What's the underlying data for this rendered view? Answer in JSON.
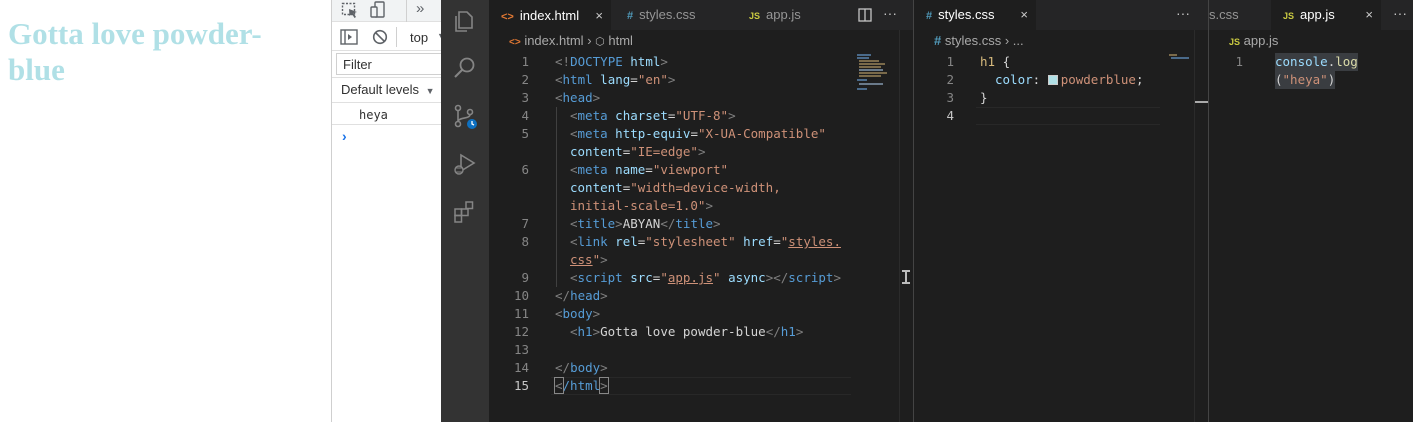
{
  "page": {
    "heading": "Gotta love powder-blue"
  },
  "devtools": {
    "context": "top",
    "filter_placeholder": "Filter",
    "levels_label": "Default levels",
    "log_entry": "heya",
    "prompt": "›"
  },
  "editor1": {
    "tabs": [
      {
        "icon": "<>",
        "label": "index.html",
        "close": "×"
      },
      {
        "icon": "#",
        "label": "styles.css"
      },
      {
        "icon": "JS",
        "label": "app.js"
      }
    ],
    "breadcrumb": {
      "file": "index.html",
      "sep": "›",
      "node": "html"
    },
    "line_numbers": [
      "1",
      "2",
      "3",
      "4",
      "5",
      "6",
      "7",
      "8",
      "9",
      "10",
      "11",
      "12",
      "13",
      "14",
      "15"
    ],
    "code": {
      "l1": {
        "a": "<!",
        "b": "DOCTYPE",
        "c": " html",
        "d": ">"
      },
      "l2": {
        "a": "<",
        "b": "html",
        "c": " lang",
        "d": "=",
        "e": "\"en\"",
        "f": ">"
      },
      "l3": {
        "a": "<",
        "b": "head",
        "c": ">"
      },
      "l4": {
        "a": "<",
        "b": "meta",
        "c": " charset",
        "d": "=",
        "e": "\"UTF-8\"",
        "f": ">"
      },
      "l5a": {
        "a": "<",
        "b": "meta",
        "c": " http-equiv",
        "d": "=",
        "e": "\"X-UA-Compatible\""
      },
      "l5b": {
        "a": "content",
        "b": "=",
        "c": "\"IE=edge\"",
        "d": ">"
      },
      "l6a": {
        "a": "<",
        "b": "meta",
        "c": " name",
        "d": "=",
        "e": "\"viewport\""
      },
      "l6b": {
        "a": "content",
        "b": "=",
        "c": "\"width=device-width,"
      },
      "l6c": {
        "a": "initial-scale=1.0\"",
        "b": ">"
      },
      "l7": {
        "a": "<",
        "b": "title",
        "c": ">",
        "d": "ABYAN",
        "e": "</",
        "f": "title",
        "g": ">"
      },
      "l8a": {
        "a": "<",
        "b": "link",
        "c": " rel",
        "d": "=",
        "e": "\"stylesheet\"",
        "f": " href",
        "g": "=",
        "h": "\"",
        "i": "styles."
      },
      "l8b": {
        "a": "css",
        "b": "\"",
        "c": ">"
      },
      "l9": {
        "a": "<",
        "b": "script",
        "c": " src",
        "d": "=",
        "e": "\"",
        "f": "app.js",
        "g": "\"",
        "h": " async",
        "i": "></",
        "j": "script",
        "k": ">"
      },
      "l10": {
        "a": "</",
        "b": "head",
        "c": ">"
      },
      "l11": {
        "a": "<",
        "b": "body",
        "c": ">"
      },
      "l12": {
        "a": "<",
        "b": "h1",
        "c": ">",
        "d": "Gotta love powder-blue",
        "e": "</",
        "f": "h1",
        "g": ">"
      },
      "l14": {
        "a": "</",
        "b": "body",
        "c": ">"
      },
      "l15": {
        "a": "<",
        "b": "/html",
        "c": ">"
      }
    }
  },
  "editor2": {
    "tabs": [
      {
        "icon": "#",
        "label": "styles.css",
        "close": "×"
      }
    ],
    "breadcrumb": {
      "file": "styles.css",
      "sep": "›",
      "node": "..."
    },
    "line_numbers": [
      "1",
      "2",
      "3",
      "4"
    ],
    "code": {
      "l1": {
        "a": "h1",
        "b": " {"
      },
      "l2": {
        "a": "color",
        "b": ": ",
        "c": "powderblue",
        "d": ";"
      },
      "l3": {
        "a": "}"
      }
    },
    "swatch_color": "#b0e0e6"
  },
  "editor3": {
    "tabs": [
      {
        "label": "s.css"
      },
      {
        "icon": "JS",
        "label": "app.js",
        "close": "×"
      }
    ],
    "breadcrumb": {
      "file": "app.js"
    },
    "line_numbers": [
      "1"
    ],
    "code": {
      "a": "console",
      "b": ".",
      "c": "log",
      "d": "(",
      "e": "\"heya\"",
      "f": ")"
    }
  },
  "more_actions": "···"
}
